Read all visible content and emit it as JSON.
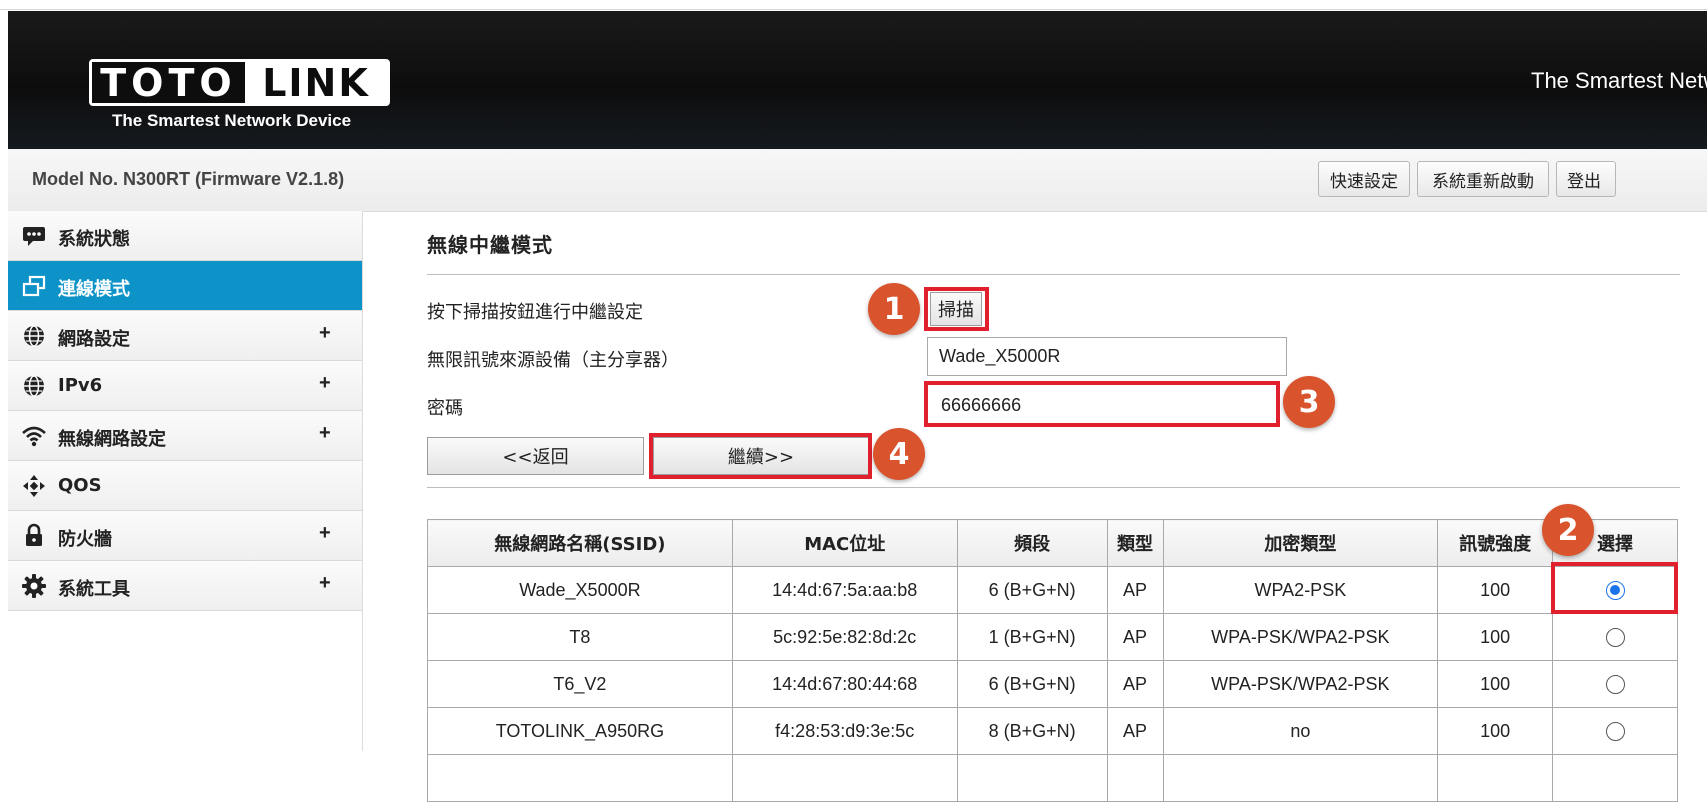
{
  "header": {
    "logo_left": "TOTO",
    "logo_right": "LINK",
    "logo_tagline": "The Smartest Network Device",
    "slogan": "The Smartest Network Device"
  },
  "modelbar": {
    "model": "Model No. N300RT (Firmware V2.1.8)",
    "buttons": [
      "快速設定",
      "系統重新啟動",
      "登出"
    ]
  },
  "sidebar": {
    "items": [
      {
        "label": "系統狀態",
        "icon": "chat-bubble-icon",
        "expandable": false,
        "active": false
      },
      {
        "label": "連線模式",
        "icon": "windows-icon",
        "expandable": false,
        "active": true
      },
      {
        "label": "網路設定",
        "icon": "globe-icon",
        "expandable": true,
        "active": false
      },
      {
        "label": "IPv6",
        "icon": "globe-icon",
        "expandable": true,
        "active": false
      },
      {
        "label": "無線網路設定",
        "icon": "wifi-icon",
        "expandable": true,
        "active": false
      },
      {
        "label": "QOS",
        "icon": "arrows-icon",
        "expandable": false,
        "active": false
      },
      {
        "label": "防火牆",
        "icon": "lock-icon",
        "expandable": true,
        "active": false
      },
      {
        "label": "系統工具",
        "icon": "gear-icon",
        "expandable": true,
        "active": false
      }
    ],
    "plus_symbol": "+"
  },
  "main": {
    "title": "無線中繼模式",
    "scan_prompt": "按下掃描按鈕進行中繼設定",
    "scan_button": "掃描",
    "source_label": "無限訊號來源設備（主分享器）",
    "source_value": "Wade_X5000R",
    "password_label": "密碼",
    "password_value": "66666666",
    "back_button": "<<返回",
    "next_button": "繼續>>"
  },
  "badges": {
    "b1": "1",
    "b2": "2",
    "b3": "3",
    "b4": "4"
  },
  "table": {
    "headers": [
      "無線網路名稱(SSID)",
      "MAC位址",
      "頻段",
      "類型",
      "加密類型",
      "訊號強度",
      "選擇"
    ],
    "rows": [
      {
        "ssid": "Wade_X5000R",
        "mac": "14:4d:67:5a:aa:b8",
        "band": "6 (B+G+N)",
        "type": "AP",
        "enc": "WPA2-PSK",
        "signal": "100",
        "selected": true
      },
      {
        "ssid": "T8",
        "mac": "5c:92:5e:82:8d:2c",
        "band": "1 (B+G+N)",
        "type": "AP",
        "enc": "WPA-PSK/WPA2-PSK",
        "signal": "100",
        "selected": false
      },
      {
        "ssid": "T6_V2",
        "mac": "14:4d:67:80:44:68",
        "band": "6 (B+G+N)",
        "type": "AP",
        "enc": "WPA-PSK/WPA2-PSK",
        "signal": "100",
        "selected": false
      },
      {
        "ssid": "TOTOLINK_A950RG",
        "mac": "f4:28:53:d9:3e:5c",
        "band": "8 (B+G+N)",
        "type": "AP",
        "enc": "no",
        "signal": "100",
        "selected": false
      }
    ]
  },
  "colors": {
    "accent": "#0e93c8",
    "highlight": "#e0202d",
    "badge": "#d9542d"
  }
}
